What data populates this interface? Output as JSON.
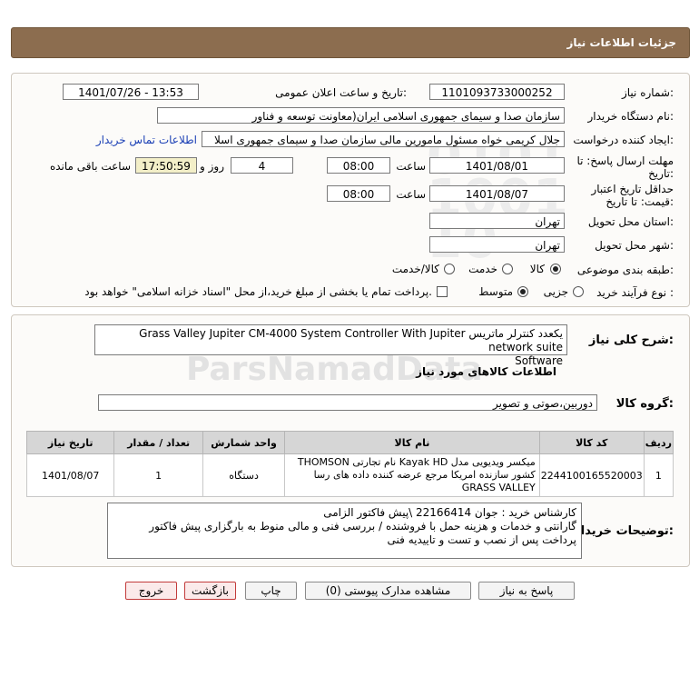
{
  "header": {
    "title": "جزئیات اطلاعات نیاز"
  },
  "form": {
    "need_number_label": "شماره نیاز:",
    "need_number": "1101093733000252",
    "announce_label": "تاریخ و ساعت اعلان عمومی:",
    "announce_value": "1401/07/26 - 13:53",
    "buyer_org_label": "نام دستگاه خریدار:",
    "buyer_org": "سازمان صدا و سیمای جمهوری اسلامی ایران(معاونت توسعه و فناور",
    "creator_label": "ایجاد کننده درخواست:",
    "creator": "جلال کریمی خواه مسئول مامورین مالی  سازمان صدا و سیمای جمهوری اسلا",
    "contact_link": "اطلاعات تماس خریدار",
    "deadline_label_1": "مهلت ارسال پاسخ: تا",
    "deadline_label_2": "تاریخ:",
    "deadline_date": "1401/08/01",
    "time_label": "ساعت",
    "deadline_time": "08:00",
    "days_value": "4",
    "days_label": "روز و",
    "remaining_time": "17:50:59",
    "remaining_label": "ساعت باقی مانده",
    "validity_label_1": "حداقل تاریخ اعتبار",
    "validity_label_2": "قیمت: تا تاریخ:",
    "validity_date": "1401/08/07",
    "validity_time": "08:00",
    "province_label": "استان محل تحویل:",
    "province": "تهران",
    "city_label": "شهر محل تحویل:",
    "city": "تهران",
    "category_label": "طبقه بندی موضوعی:",
    "category_options": [
      "کالا",
      "خدمت",
      "کالا/خدمت"
    ],
    "process_label": "نوع فرآیند خرید :",
    "process_options": [
      "جزیی",
      "متوسط"
    ],
    "payment_text": "پرداخت تمام یا بخشی از مبلغ خرید،از محل \"اسناد خزانه اسلامی\" خواهد بود."
  },
  "details": {
    "summary_label": "شرح کلی نیاز:",
    "summary_line1": "یکعدد کنترلر ماتریس Grass Valley Jupiter CM-4000 System Controller With Jupiter network suite",
    "summary_line2": "Software",
    "goods_info_title": "اطلاعات کالاهای مورد نیاز",
    "goods_group_label": "گروه کالا:",
    "goods_group": "دوربین،صوتی و تصویر",
    "table": {
      "headers": [
        "ردیف",
        "کد کالا",
        "نام کالا",
        "واحد شمارش",
        "تعداد / مقدار",
        "تاریخ نیاز"
      ],
      "rows": [
        {
          "row": "1",
          "code": "2244100165520003",
          "name": "میکسر ویدیویی مدل Kayak HD نام تجارتی THOMSON کشور سازنده امریکا مرجع عرضه کننده داده های رسا GRASS VALLEY",
          "unit": "دستگاه",
          "qty": "1",
          "date": "1401/08/07"
        }
      ]
    },
    "buyer_notes_label": "توضیحات خریدار:",
    "buyer_notes": [
      "کارشناس خرید : جوان 22166414 \\پیش فاکتور الزامی",
      "گارانتی و خدمات و هزینه حمل با فروشنده / بررسی فنی و مالی منوط به بارگزاری پیش فاکتور",
      "پرداخت پس از نصب و تست و تاییدیه فنی"
    ]
  },
  "buttons": {
    "reply": "پاسخ به نیاز",
    "attachments": "مشاهده مدارک پیوستی (0)",
    "print": "چاپ",
    "back": "بازگشت",
    "exit": "خروج"
  }
}
